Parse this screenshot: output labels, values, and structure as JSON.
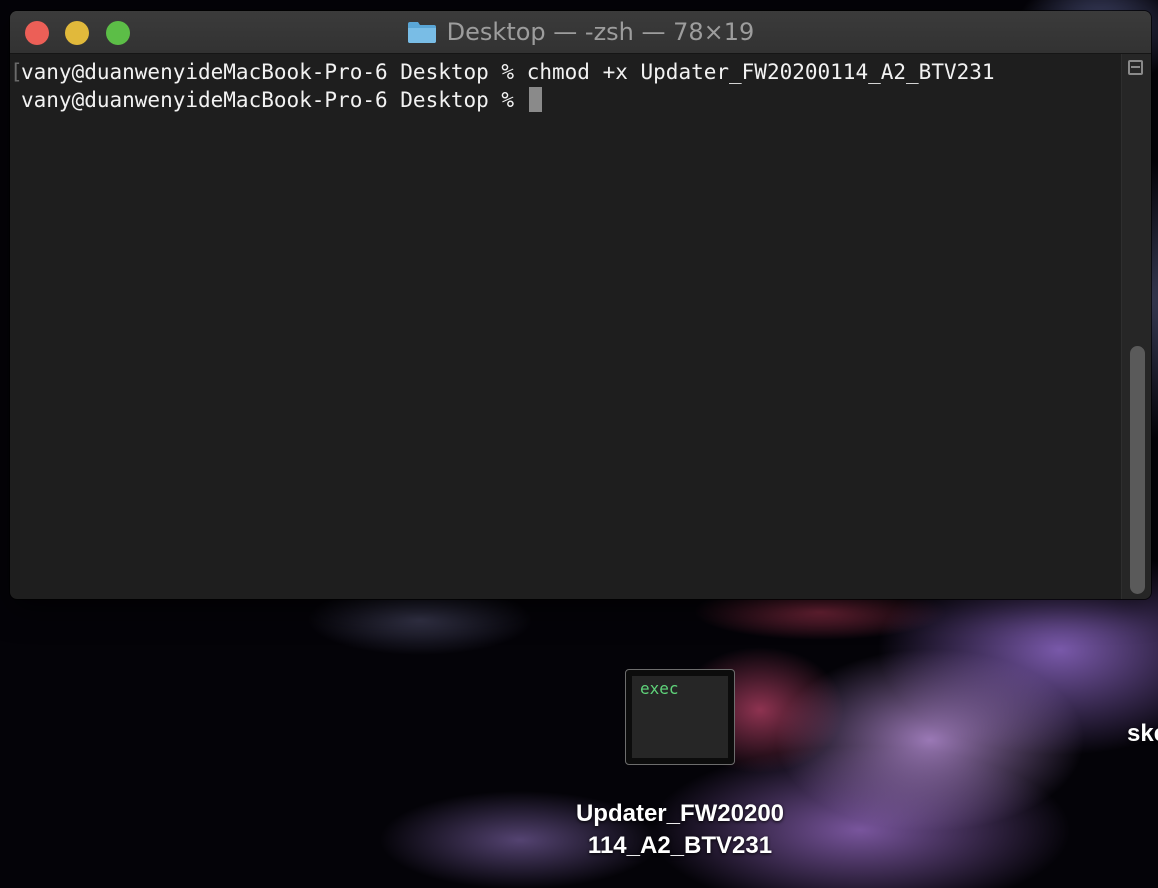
{
  "window": {
    "title": "Desktop — -zsh — 78×19",
    "folder_icon": "folder-icon"
  },
  "terminal": {
    "lines": [
      {
        "prompt": "vany@duanwenyideMacBook-Pro-6 Desktop % ",
        "command": "chmod +x Updater_FW20200114_A2_BTV231"
      },
      {
        "prompt": "vany@duanwenyideMacBook-Pro-6 Desktop % ",
        "command": ""
      }
    ],
    "left_bracket": "[",
    "right_bracket": "]"
  },
  "desktop": {
    "file": {
      "icon_text": "exec",
      "label_line1": "Updater_FW20200",
      "label_line2": "114_A2_BTV231"
    },
    "partial_item_label": "ske"
  },
  "colors": {
    "close": "#ec5f57",
    "minimize": "#e1b93b",
    "maximize": "#5cbe47",
    "exec_text": "#5fd37a"
  }
}
